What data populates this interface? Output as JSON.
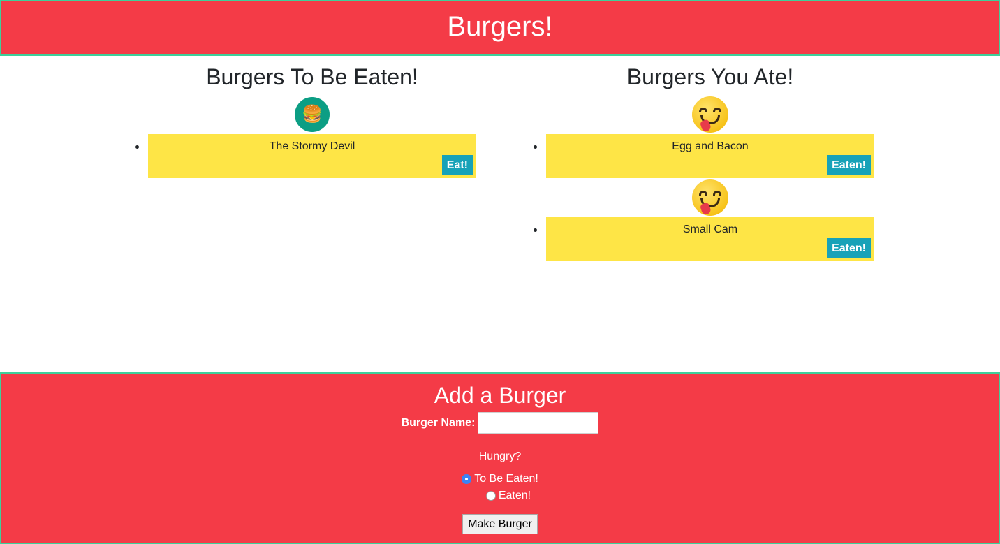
{
  "header": {
    "title": "Burgers!"
  },
  "left_column": {
    "title": "Burgers To Be Eaten!",
    "items": [
      {
        "name": "The Stormy Devil",
        "button_label": "Eat!",
        "icon": "hamburger-icon"
      }
    ]
  },
  "right_column": {
    "title": "Burgers You Ate!",
    "items": [
      {
        "name": "Egg and Bacon",
        "button_label": "Eaten!",
        "icon": "yum-face-icon"
      },
      {
        "name": "Small Cam",
        "button_label": "Eaten!",
        "icon": "yum-face-icon"
      }
    ]
  },
  "form": {
    "title": "Add a Burger",
    "name_label": "Burger Name:",
    "name_value": "",
    "hungry_label": "Hungry?",
    "options": [
      {
        "label": "To Be Eaten!",
        "checked": true
      },
      {
        "label": "Eaten!",
        "checked": false
      }
    ],
    "submit_label": "Make Burger"
  },
  "colors": {
    "brand_red": "#f43b47",
    "border_green": "#3ecf9a",
    "card_yellow": "#fee546",
    "button_teal": "#17a2b8",
    "burger_icon_bg": "#0c9e84"
  }
}
